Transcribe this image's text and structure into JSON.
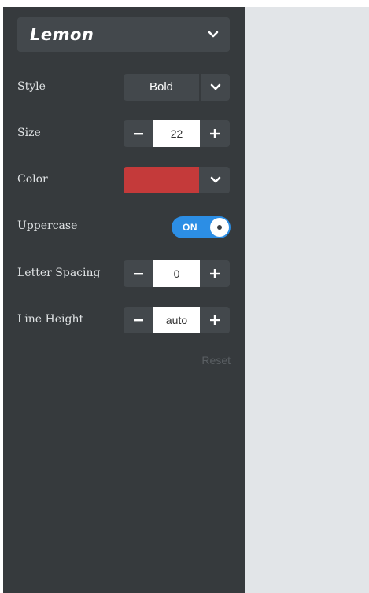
{
  "font_select": {
    "value": "Lemon",
    "icon": "chevron-down-icon"
  },
  "style": {
    "label": "Style",
    "value": "Bold"
  },
  "size": {
    "label": "Size",
    "value": "22"
  },
  "color": {
    "label": "Color",
    "value": "#c43a3a"
  },
  "uppercase": {
    "label": "Uppercase",
    "state": "ON",
    "accent": "#2c8ee5"
  },
  "letter_spacing": {
    "label": "Letter Spacing",
    "value": "0"
  },
  "line_height": {
    "label": "Line Height",
    "value": "auto"
  },
  "reset_label": "Reset"
}
